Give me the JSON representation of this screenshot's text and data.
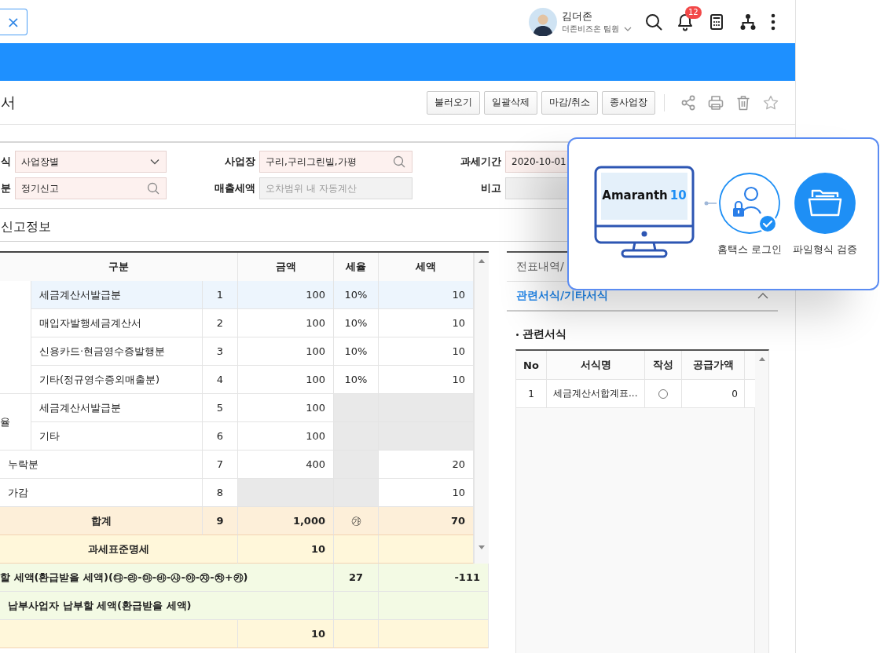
{
  "header": {
    "close_icon": "×",
    "user": {
      "name": "김더존",
      "role": "더존비즈온 팀원"
    },
    "notification_count": "12"
  },
  "page": {
    "title": "서",
    "buttons": [
      "불러오기",
      "일괄삭제",
      "마감/취소",
      "종사업장"
    ]
  },
  "filters": [
    [
      {
        "label": "식",
        "kind": "select",
        "value": "사업장별",
        "required": true,
        "disabled": false
      },
      {
        "label": "사업장",
        "kind": "search",
        "value": "구리,구리그린빌,가평",
        "required": true,
        "disabled": false
      },
      {
        "label": "과세기간",
        "kind": "plain",
        "value": "2020-10-01",
        "required": true,
        "disabled": false
      }
    ],
    [
      {
        "label": "분",
        "kind": "search",
        "value": "정기신고",
        "required": true,
        "disabled": false
      },
      {
        "label": "매출세액",
        "kind": "plain",
        "placeholder": "오차범위 내 자동계산",
        "required": false,
        "disabled": true
      },
      {
        "label": "비고",
        "kind": "plain",
        "required": false,
        "disabled": true
      }
    ]
  ],
  "section_title": "신고정보",
  "report_table": {
    "columns": [
      "구분",
      "금액",
      "세율",
      "세액"
    ],
    "rows": [
      {
        "kind": "group",
        "rows": [
          {
            "label": "세금계산서발급분",
            "no": "1",
            "amount": "100",
            "rate": "10%",
            "tax": "10",
            "selected": true,
            "amount_locked": false,
            "rate_locked": false,
            "tax_locked": false
          },
          {
            "label": "매입자발행세금계산서",
            "no": "2",
            "amount": "100",
            "rate": "10%",
            "tax": "10",
            "selected": false,
            "amount_locked": false,
            "rate_locked": false,
            "tax_locked": false
          },
          {
            "label": "신용카드·현금영수증발행분",
            "no": "3",
            "amount": "100",
            "rate": "10%",
            "tax": "10",
            "selected": false,
            "amount_locked": false,
            "rate_locked": false,
            "tax_locked": false
          },
          {
            "label": "기타(정규영수증외매출분)",
            "no": "4",
            "amount": "100",
            "rate": "10%",
            "tax": "10",
            "selected": false,
            "amount_locked": false,
            "rate_locked": false,
            "tax_locked": false
          }
        ]
      },
      {
        "kind": "group",
        "label": "율",
        "rows": [
          {
            "label": "세금계산서발급분",
            "no": "5",
            "amount": "100",
            "selected": false,
            "amount_locked": false,
            "rate_locked": true,
            "tax_locked": true
          },
          {
            "label": "기타",
            "no": "6",
            "amount": "100",
            "selected": false,
            "amount_locked": false,
            "rate_locked": true,
            "tax_locked": true
          }
        ]
      },
      {
        "kind": "single",
        "label": "누락분",
        "no": "7",
        "amount": "400",
        "tax": "20",
        "selected": false,
        "amount_locked": false,
        "rate_locked": true,
        "tax_locked": false
      },
      {
        "kind": "single",
        "label": "가감",
        "no": "8",
        "tax": "10",
        "selected": false,
        "amount_locked": true,
        "rate_locked": true,
        "tax_locked": false
      },
      {
        "kind": "total",
        "label": "합계",
        "no": "9",
        "amount": "1,000",
        "rate": "㉮",
        "tax": "70"
      },
      {
        "kind": "standard",
        "label": "과세표준명세",
        "amount": "10"
      }
    ],
    "footer_rows": [
      {
        "kind": "payable",
        "label": "할 세액(환급받을 세액)(㉰-㉱-㉲-㉳-㉴-㉵-㉶-㉷+㉸)",
        "rate": "27",
        "tax": "-111"
      },
      {
        "kind": "payable",
        "label": "납부사업자 납부할 세액(환급받을 세액)"
      },
      {
        "kind": "standard",
        "amount": "10"
      }
    ]
  },
  "side_panel": {
    "sections": [
      {
        "title": "전표내역/",
        "expanded": false
      },
      {
        "title": "관련서식/기타서식",
        "expanded": true
      }
    ],
    "forms": {
      "title": "관련서식",
      "columns": [
        "No",
        "서식명",
        "작성",
        "공급가액"
      ],
      "rows": [
        {
          "no": "1",
          "name": "세금계산서합계표...",
          "written": false,
          "amount": "0"
        }
      ]
    }
  },
  "popup": {
    "brand": "Amaranth",
    "version": "10",
    "steps": [
      {
        "kind": "login",
        "label": "홈택스 로그인",
        "filled": false,
        "done": true
      },
      {
        "kind": "file",
        "label": "파일형식 검증",
        "filled": true,
        "done": false
      }
    ]
  }
}
